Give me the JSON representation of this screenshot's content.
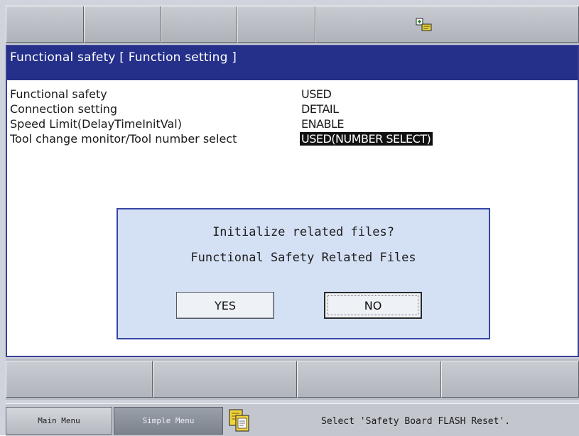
{
  "window": {
    "title": "Functional safety [ Function setting ]"
  },
  "settings": [
    {
      "label": "Functional safety",
      "value": "USED"
    },
    {
      "label": "Connection setting",
      "value": "DETAIL"
    },
    {
      "label": "Speed Limit(DelayTimeInitVal)",
      "value": "ENABLE"
    },
    {
      "label": "Tool change monitor/Tool number select",
      "value": "USED(NUMBER SELECT)"
    }
  ],
  "dialog": {
    "line1": "Initialize related files?",
    "line2": "Functional Safety Related Files",
    "yes_label": "YES",
    "no_label": "NO"
  },
  "bottom_bar": {
    "main_menu_label": "Main Menu",
    "simple_menu_label": "Simple Menu",
    "message": "Select 'Safety Board FLASH Reset'."
  },
  "icons": {
    "status": "status-indicator-icon",
    "clipboard": "clipboard-icon"
  },
  "colors": {
    "title_bar": "#24308a",
    "dialog_bg": "#d4e0f4",
    "dialog_border": "#3746a6",
    "selected_bg": "#111111"
  }
}
